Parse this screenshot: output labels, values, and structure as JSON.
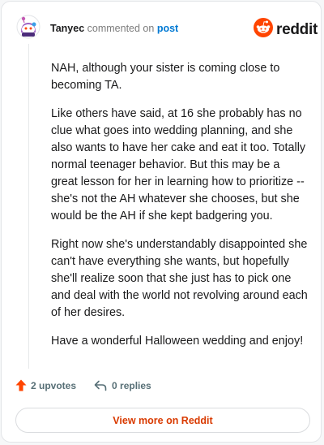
{
  "header": {
    "author": "Tanyec",
    "action_text": "commented on",
    "post_link": "post",
    "brand": "reddit"
  },
  "comment": {
    "paragraphs": [
      "NAH, although your sister is coming close to becoming TA.",
      "Like others have said, at 16 she probably has no clue what goes into wedding planning, and she also wants to have her cake and eat it too. Totally normal teenager behavior. But this may be a great lesson for her in learning how to prioritize -- she's not the AH whatever she chooses, but she would be the AH if she kept badgering you.",
      "Right now she's understandably disappointed she can't have everything she wants, but hopefully she'll realize soon that she just has to pick one and deal with the world not revolving around each of her desires.",
      "Have a wonderful Halloween wedding and enjoy!"
    ]
  },
  "actions": {
    "upvotes": "2 upvotes",
    "replies": "0 replies"
  },
  "footer": {
    "view_more": "View more on Reddit"
  },
  "colors": {
    "accent_orange": "#ff4500",
    "link_blue": "#0079d3",
    "view_more_text": "#d93a00"
  }
}
